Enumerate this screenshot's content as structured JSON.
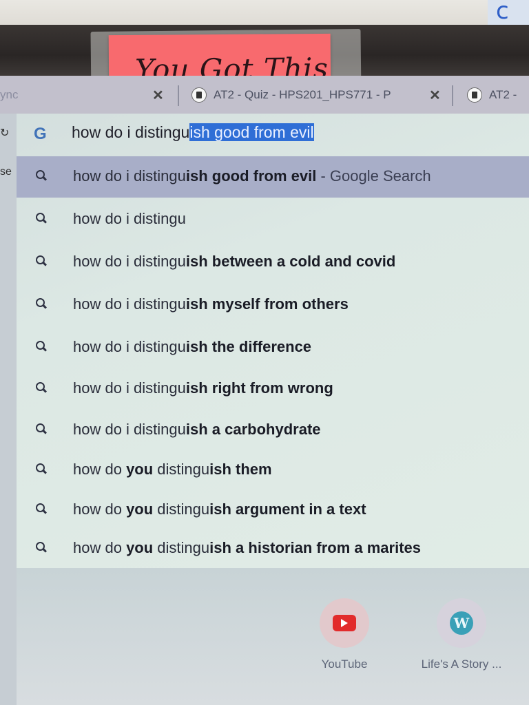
{
  "sticky_note": {
    "text": "You Got This"
  },
  "tabs": [
    {
      "label": "ync",
      "close": "✕"
    },
    {
      "label": "AT2 - Quiz - HPS201_HPS771 - P",
      "close": "✕"
    },
    {
      "label": "AT2 -"
    }
  ],
  "left_page": {
    "fragment": "se"
  },
  "omnibox": {
    "typed": "how do i distingu",
    "autocomplete": "ish good from evil"
  },
  "suggestions": [
    {
      "plain": "how do i distingu",
      "bold": "ish good from evil",
      "suffix": " - Google Search"
    },
    {
      "plain": "how do i distingu",
      "bold": "",
      "suffix": ""
    },
    {
      "plain": "how do i distingu",
      "bold": "ish between a cold and covid",
      "suffix": ""
    },
    {
      "plain": "how do i distingu",
      "bold": "ish myself from others",
      "suffix": ""
    },
    {
      "plain": "how do i distingu",
      "bold": "ish the difference",
      "suffix": ""
    },
    {
      "plain": "how do i distingu",
      "bold": "ish right from wrong",
      "suffix": ""
    },
    {
      "plain": "how do i distingu",
      "bold": "ish a carbohydrate",
      "suffix": ""
    },
    {
      "plain": "how do ",
      "bold": "you",
      "plain2": " distingu",
      "bold2": "ish them"
    },
    {
      "plain": "how do ",
      "bold": "you",
      "plain2": " distingu",
      "bold2": "ish argument in a text"
    },
    {
      "plain": "how do ",
      "bold": "you",
      "plain2": " distingu",
      "bold2": "ish a historian from a marites"
    }
  ],
  "shortcuts": [
    {
      "label": "YouTube",
      "icon": "youtube-icon"
    },
    {
      "label": "Life's A Story ...",
      "icon": "wordpress-icon"
    }
  ]
}
